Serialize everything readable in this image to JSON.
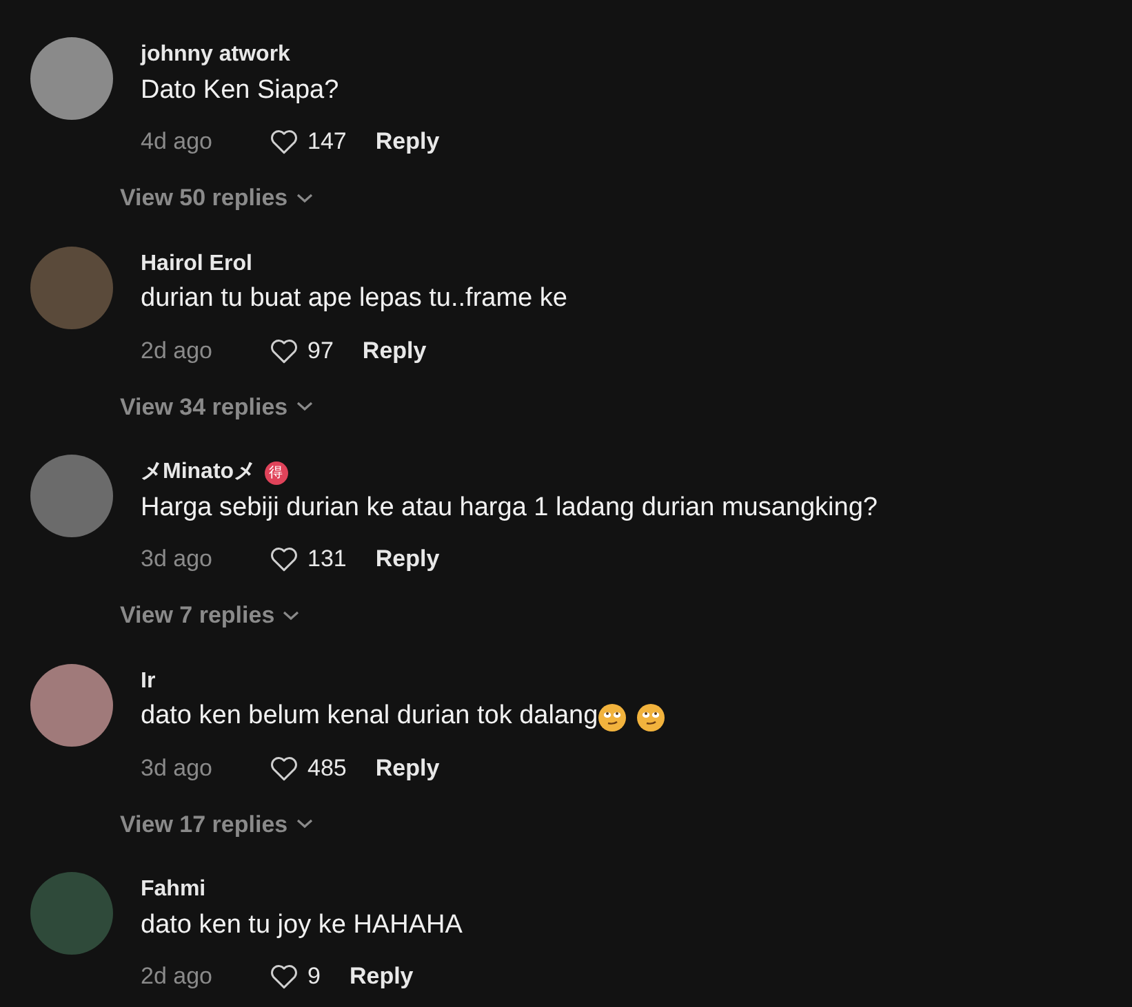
{
  "comments": [
    {
      "user": "johnny atwork",
      "text": "Dato Ken Siapa?",
      "time": "4d ago",
      "likes": "147",
      "reply": "Reply",
      "view_replies": "View 50 replies"
    },
    {
      "user": "Hairol Erol",
      "text": "durian tu buat ape lepas tu..frame ke",
      "time": "2d ago",
      "likes": "97",
      "reply": "Reply",
      "view_replies": "View 34 replies"
    },
    {
      "user": "メMinatoメ",
      "badge": "得",
      "text": "Harga sebiji durian ke atau harga 1 ladang durian musangking?",
      "time": "3d ago",
      "likes": "131",
      "reply": "Reply",
      "view_replies": "View 7 replies"
    },
    {
      "user": "Ir",
      "text": "dato ken belum kenal durian tok dalang",
      "emojis": [
        {
          "kind": "rolling-eyes"
        },
        {
          "kind": "rolling-eyes"
        }
      ],
      "time": "3d ago",
      "likes": "485",
      "reply": "Reply",
      "view_replies": "View 17 replies"
    },
    {
      "user": "Fahmi",
      "text": "dato ken tu joy ke HAHAHA",
      "time": "2d ago",
      "likes": "9",
      "reply": "Reply"
    }
  ]
}
